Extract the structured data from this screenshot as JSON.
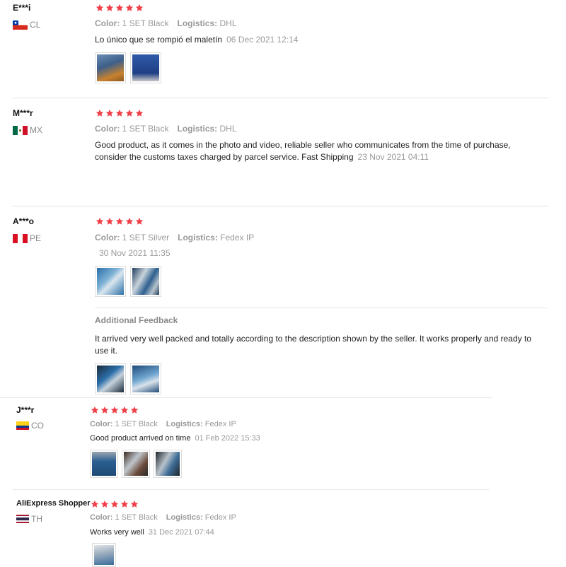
{
  "labels": {
    "color": "Color:",
    "logistics": "Logistics:",
    "additional_feedback": "Additional Feedback"
  },
  "colors": {
    "star": "#f0414a",
    "muted": "#999999"
  },
  "reviews": [
    {
      "user": "E***i",
      "country": "CL",
      "stars": 5,
      "color": "1 SET Black",
      "logistics": "DHL",
      "text": "Lo único que se rompió el maletín",
      "date": "06 Dec 2021 12:14",
      "images": 2
    },
    {
      "user": "M***r",
      "country": "MX",
      "stars": 5,
      "color": "1 SET Black",
      "logistics": "DHL",
      "text": "Good product, as it comes in the photo and video, reliable seller who communicates from the time of purchase, consider the customs taxes charged by parcel service. Fast Shipping",
      "date": "23 Nov 2021 04:11",
      "images": 0
    },
    {
      "user": "A***o",
      "country": "PE",
      "stars": 5,
      "color": "1 SET Silver",
      "logistics": "Fedex IP",
      "text": "",
      "date": "30 Nov 2021 11:35",
      "images": 2,
      "additional": {
        "text": "It arrived very well packed and totally according to the description shown by the seller. It works properly and ready to use it.",
        "images": 2
      }
    },
    {
      "user": "J***r",
      "country": "CO",
      "stars": 5,
      "color": "1 SET Black",
      "logistics": "Fedex IP",
      "text": "Good product arrived on time",
      "date": "01 Feb 2022 15:33",
      "images": 3
    },
    {
      "user": "AliExpress Shopper",
      "country": "TH",
      "stars": 5,
      "color": "1 SET Black",
      "logistics": "Fedex IP",
      "text": "Works very well",
      "date": "31 Dec 2021 07:44",
      "images": 1
    }
  ]
}
